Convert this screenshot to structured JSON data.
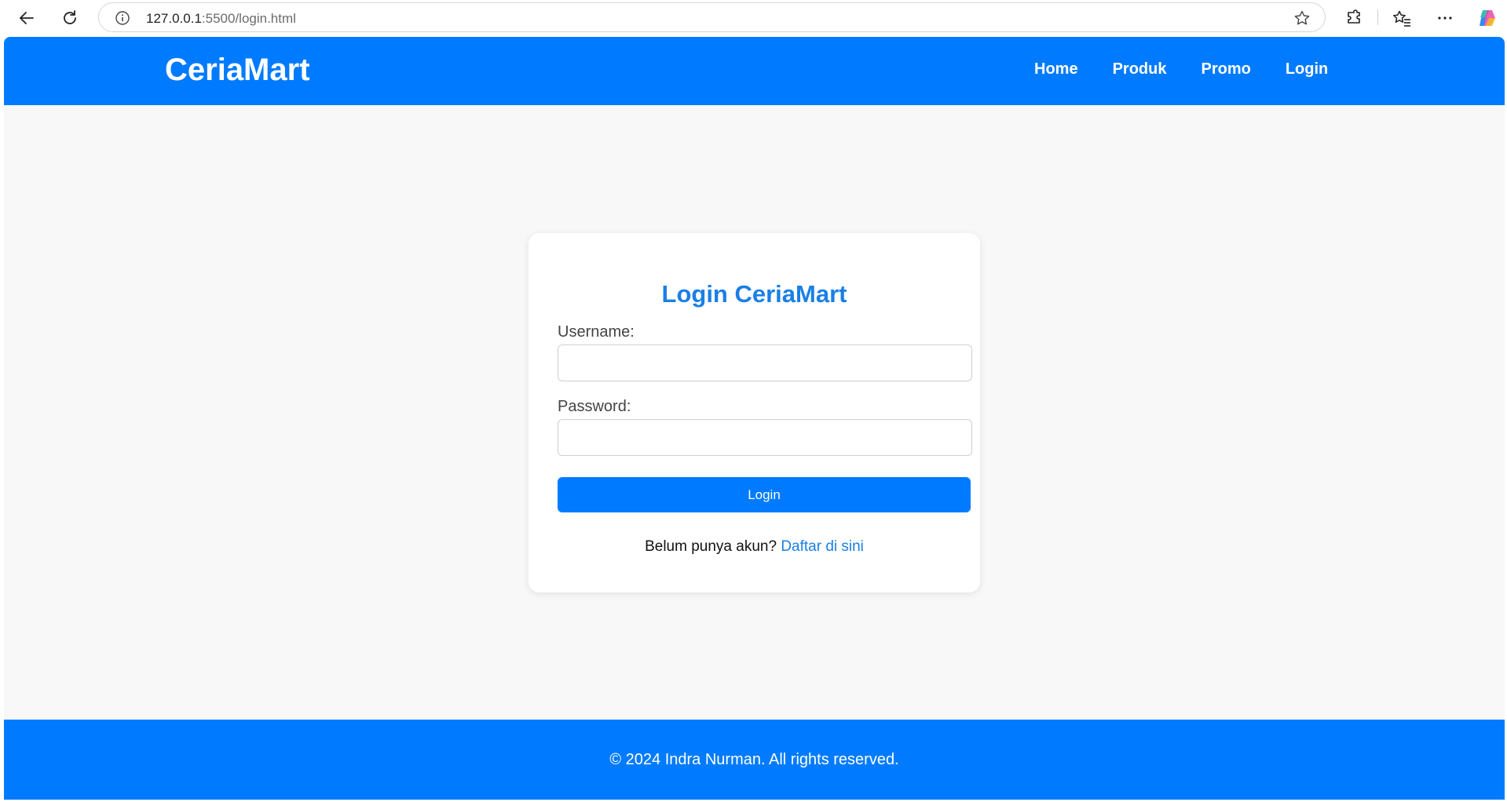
{
  "browser": {
    "url_host": "127.0.0.1",
    "url_rest": ":5500/login.html",
    "icons": [
      "back-icon",
      "reload-icon",
      "info-icon",
      "star-icon",
      "extensions-icon",
      "favorites-icon",
      "more-icon",
      "copilot-icon"
    ]
  },
  "header": {
    "brand": "CeriaMart",
    "nav": [
      "Home",
      "Produk",
      "Promo",
      "Login"
    ]
  },
  "login": {
    "title": "Login CeriaMart",
    "username_label": "Username:",
    "username_value": "",
    "password_label": "Password:",
    "password_value": "",
    "button_label": "Login",
    "register_prompt": "Belum punya akun?",
    "register_link": "Daftar di sini"
  },
  "footer": {
    "text": "© 2024 Indra Nurman. All rights reserved."
  },
  "colors": {
    "primary": "#007bff",
    "title": "#1a7fe6",
    "page_bg": "#f8f8f8"
  }
}
